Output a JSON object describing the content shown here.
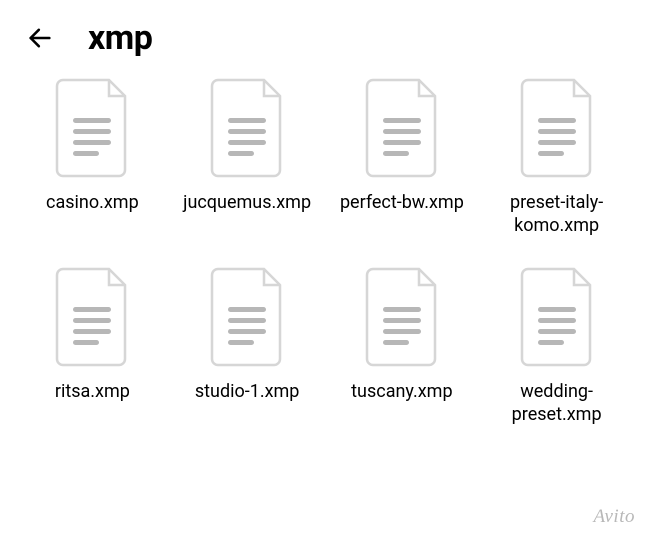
{
  "header": {
    "title": "xmp"
  },
  "files": [
    {
      "name": "casino.xmp"
    },
    {
      "name": "jucquemus.xmp"
    },
    {
      "name": "perfect-bw.xmp"
    },
    {
      "name": "preset-italy-komo.xmp"
    },
    {
      "name": "ritsa.xmp"
    },
    {
      "name": "studio-1.xmp"
    },
    {
      "name": "tuscany.xmp"
    },
    {
      "name": "wedding-preset.xmp"
    }
  ],
  "watermark": "Avito"
}
